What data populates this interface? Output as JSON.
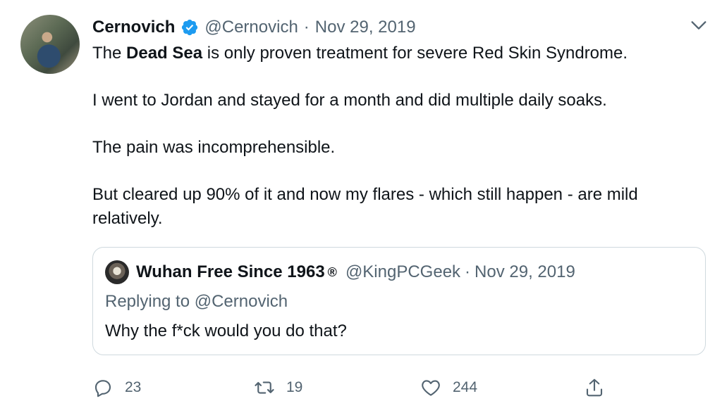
{
  "tweet": {
    "author_name": "Cernovich",
    "handle": "@Cernovich",
    "separator": "·",
    "date": "Nov 29, 2019",
    "line1_prefix": "The ",
    "line1_bold": "Dead Sea",
    "line1_suffix": " is only proven treatment for severe Red Skin Syndrome.",
    "line2": "I went to Jordan and stayed for a month and did multiple daily soaks.",
    "line3": "The pain was incomprehensible.",
    "line4": "But cleared up 90% of it and now my flares - which still happen - are mild relatively."
  },
  "quoted": {
    "author_name": "Wuhan Free Since 1963",
    "registered_mark": "®",
    "handle": "@KingPCGeek",
    "separator": "·",
    "date": "Nov 29, 2019",
    "replying_to": "Replying to @Cernovich",
    "text": "Why the f*ck would you do that?"
  },
  "actions": {
    "replies": "23",
    "retweets": "19",
    "likes": "244"
  },
  "icons": {
    "verified": "verified-badge-icon",
    "chevron": "chevron-down-icon",
    "reply": "reply-icon",
    "retweet": "retweet-icon",
    "like": "heart-icon",
    "share": "share-icon"
  },
  "colors": {
    "verified": "#1d9bf0",
    "secondary_text": "#536471",
    "border": "#cfd9de"
  }
}
